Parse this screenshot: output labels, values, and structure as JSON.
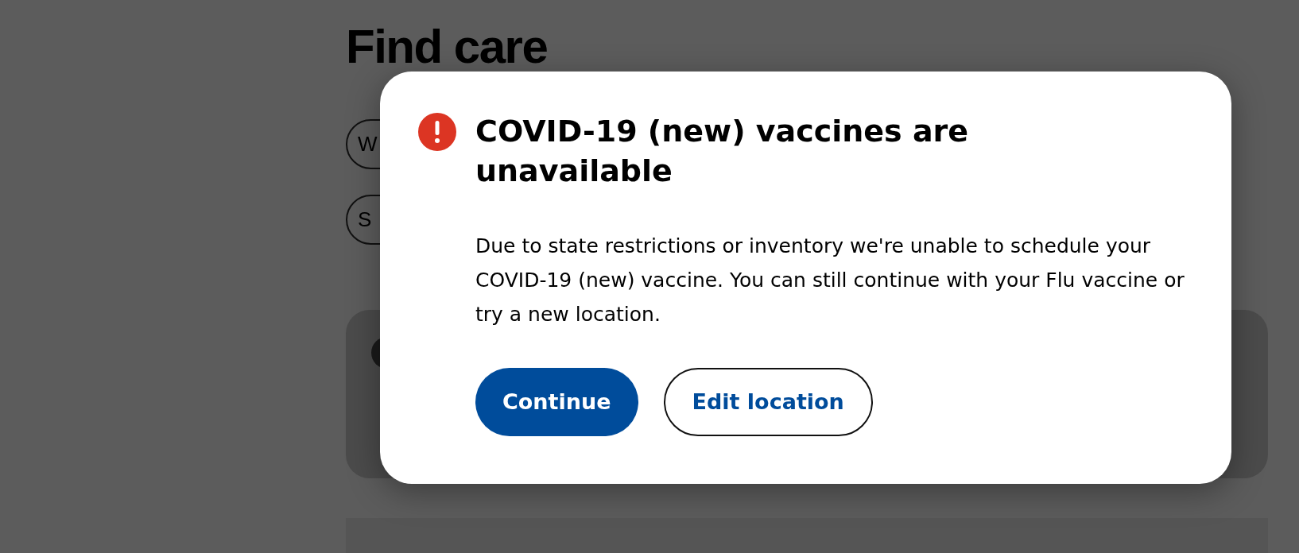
{
  "page": {
    "heading": "Find care",
    "pills": [
      {
        "label": "W"
      },
      {
        "label": "S"
      }
    ]
  },
  "dialog": {
    "title": "COVID-19 (new) vaccines are unavailable",
    "message": "Due to state restrictions or inventory we're unable to schedule your COVID-19 (new) vaccine. You can still continue with your Flu vaccine or try a new location.",
    "buttons": [
      {
        "label": "Continue",
        "kind": "primary"
      },
      {
        "label": "Edit location",
        "kind": "secondary"
      }
    ]
  }
}
